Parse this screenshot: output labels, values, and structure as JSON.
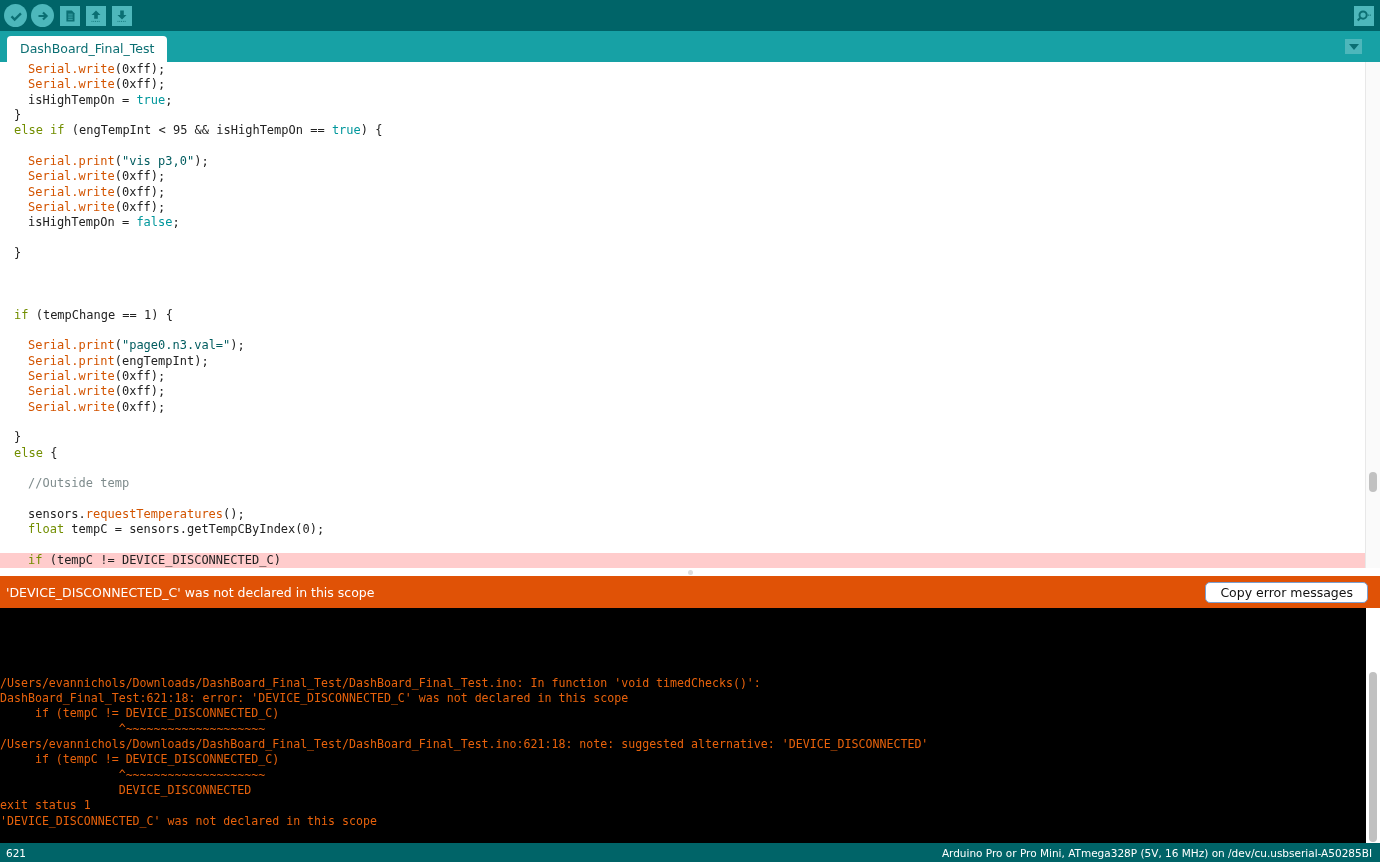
{
  "toolbar": {
    "buttons": [
      {
        "kind": "verify"
      },
      {
        "kind": "upload"
      },
      {
        "kind": "new"
      },
      {
        "kind": "open"
      },
      {
        "kind": "save"
      }
    ],
    "right_buttons": [
      {
        "kind": "serial-monitor"
      }
    ]
  },
  "tabs": [
    {
      "label": "DashBoard_Final_Test",
      "selected": true
    }
  ],
  "editor": {
    "lines": [
      {
        "highlighted": false,
        "indented": true,
        "tokens": [
          {
            "kind": "fn",
            "text": "Serial.write"
          },
          {
            "kind": "plain",
            "text": "(0xff);"
          }
        ]
      },
      {
        "highlighted": false,
        "indented": true,
        "tokens": [
          {
            "kind": "fn",
            "text": "Serial.write"
          },
          {
            "kind": "plain",
            "text": "(0xff);"
          }
        ]
      },
      {
        "highlighted": false,
        "indented": true,
        "tokens": [
          {
            "kind": "plain",
            "text": "isHighTempOn = "
          },
          {
            "kind": "lit",
            "text": "true"
          },
          {
            "kind": "plain",
            "text": ";"
          }
        ]
      },
      {
        "highlighted": false,
        "indented": false,
        "tokens": [
          {
            "kind": "plain",
            "text": "}"
          }
        ]
      },
      {
        "highlighted": false,
        "indented": false,
        "tokens": [
          {
            "kind": "kw",
            "text": "else if"
          },
          {
            "kind": "plain",
            "text": " (engTempInt < 95 && isHighTempOn == "
          },
          {
            "kind": "lit",
            "text": "true"
          },
          {
            "kind": "plain",
            "text": ") {"
          }
        ]
      },
      {
        "highlighted": false
      },
      {
        "highlighted": false,
        "indented": true,
        "tokens": [
          {
            "kind": "fn",
            "text": "Serial.print"
          },
          {
            "kind": "plain",
            "text": "("
          },
          {
            "kind": "str",
            "text": "\"vis p3,0\""
          },
          {
            "kind": "plain",
            "text": ");"
          }
        ]
      },
      {
        "highlighted": false,
        "indented": true,
        "tokens": [
          {
            "kind": "fn",
            "text": "Serial.write"
          },
          {
            "kind": "plain",
            "text": "(0xff);"
          }
        ]
      },
      {
        "highlighted": false,
        "indented": true,
        "tokens": [
          {
            "kind": "fn",
            "text": "Serial.write"
          },
          {
            "kind": "plain",
            "text": "(0xff);"
          }
        ]
      },
      {
        "highlighted": false,
        "indented": true,
        "tokens": [
          {
            "kind": "fn",
            "text": "Serial.write"
          },
          {
            "kind": "plain",
            "text": "(0xff);"
          }
        ]
      },
      {
        "highlighted": false,
        "indented": true,
        "tokens": [
          {
            "kind": "plain",
            "text": "isHighTempOn = "
          },
          {
            "kind": "lit",
            "text": "false"
          },
          {
            "kind": "plain",
            "text": ";"
          }
        ]
      },
      {
        "highlighted": false
      },
      {
        "highlighted": false,
        "indented": false,
        "tokens": [
          {
            "kind": "plain",
            "text": "}"
          }
        ]
      },
      {
        "highlighted": false
      },
      {
        "highlighted": false
      },
      {
        "highlighted": false
      },
      {
        "highlighted": false,
        "indented": false,
        "tokens": [
          {
            "kind": "kw",
            "text": "if"
          },
          {
            "kind": "plain",
            "text": " (tempChange == 1) {"
          }
        ]
      },
      {
        "highlighted": false
      },
      {
        "highlighted": false,
        "indented": true,
        "tokens": [
          {
            "kind": "fn",
            "text": "Serial.print"
          },
          {
            "kind": "plain",
            "text": "("
          },
          {
            "kind": "str",
            "text": "\"page0.n3.val=\""
          },
          {
            "kind": "plain",
            "text": ");"
          }
        ]
      },
      {
        "highlighted": false,
        "indented": true,
        "tokens": [
          {
            "kind": "fn",
            "text": "Serial.print"
          },
          {
            "kind": "plain",
            "text": "(engTempInt);"
          }
        ]
      },
      {
        "highlighted": false,
        "indented": true,
        "tokens": [
          {
            "kind": "fn",
            "text": "Serial.write"
          },
          {
            "kind": "plain",
            "text": "(0xff);"
          }
        ]
      },
      {
        "highlighted": false,
        "indented": true,
        "tokens": [
          {
            "kind": "fn",
            "text": "Serial.write"
          },
          {
            "kind": "plain",
            "text": "(0xff);"
          }
        ]
      },
      {
        "highlighted": false,
        "indented": true,
        "tokens": [
          {
            "kind": "fn",
            "text": "Serial.write"
          },
          {
            "kind": "plain",
            "text": "(0xff);"
          }
        ]
      },
      {
        "highlighted": false
      },
      {
        "highlighted": false,
        "indented": false,
        "tokens": [
          {
            "kind": "plain",
            "text": "}"
          }
        ]
      },
      {
        "highlighted": false,
        "indented": false,
        "tokens": [
          {
            "kind": "kw",
            "text": "else"
          },
          {
            "kind": "plain",
            "text": " {"
          }
        ]
      },
      {
        "highlighted": false
      },
      {
        "highlighted": false,
        "indented": true,
        "tokens": [
          {
            "kind": "comment",
            "text": "//Outside temp"
          }
        ]
      },
      {
        "highlighted": false
      },
      {
        "highlighted": false,
        "indented": true,
        "tokens": [
          {
            "kind": "plain",
            "text": "sensors."
          },
          {
            "kind": "fn",
            "text": "requestTemperatures"
          },
          {
            "kind": "plain",
            "text": "();"
          }
        ]
      },
      {
        "highlighted": false,
        "indented": true,
        "tokens": [
          {
            "kind": "kw",
            "text": "float"
          },
          {
            "kind": "plain",
            "text": " tempC = sensors.getTempCByIndex(0);"
          }
        ]
      },
      {
        "highlighted": false
      },
      {
        "highlighted": true,
        "indented": true,
        "tokens": [
          {
            "kind": "kw",
            "text": "if"
          },
          {
            "kind": "plain",
            "text": " (tempC != DEVICE_DISCONNECTED_C)"
          }
        ]
      }
    ]
  },
  "error_bar": {
    "message": "'DEVICE_DISCONNECTED_C' was not declared in this scope",
    "button": "Copy error messages"
  },
  "console": {
    "lines": [
      "/Users/evannichols/Downloads/DashBoard_Final_Test/DashBoard_Final_Test.ino: In function 'void timedChecks()':",
      "DashBoard_Final_Test:621:18: error: 'DEVICE_DISCONNECTED_C' was not declared in this scope",
      "     if (tempC != DEVICE_DISCONNECTED_C)",
      "                 ^~~~~~~~~~~~~~~~~~~~~",
      "/Users/evannichols/Downloads/DashBoard_Final_Test/DashBoard_Final_Test.ino:621:18: note: suggested alternative: 'DEVICE_DISCONNECTED'",
      "     if (tempC != DEVICE_DISCONNECTED_C)",
      "                 ^~~~~~~~~~~~~~~~~~~~~",
      "                 DEVICE_DISCONNECTED",
      "exit status 1",
      "'DEVICE_DISCONNECTED_C' was not declared in this scope"
    ]
  },
  "status_bar": {
    "line_number": "621",
    "board": "Arduino Pro or Pro Mini, ATmega328P (5V, 16 MHz) on /dev/cu.usbserial-A50285BI"
  }
}
